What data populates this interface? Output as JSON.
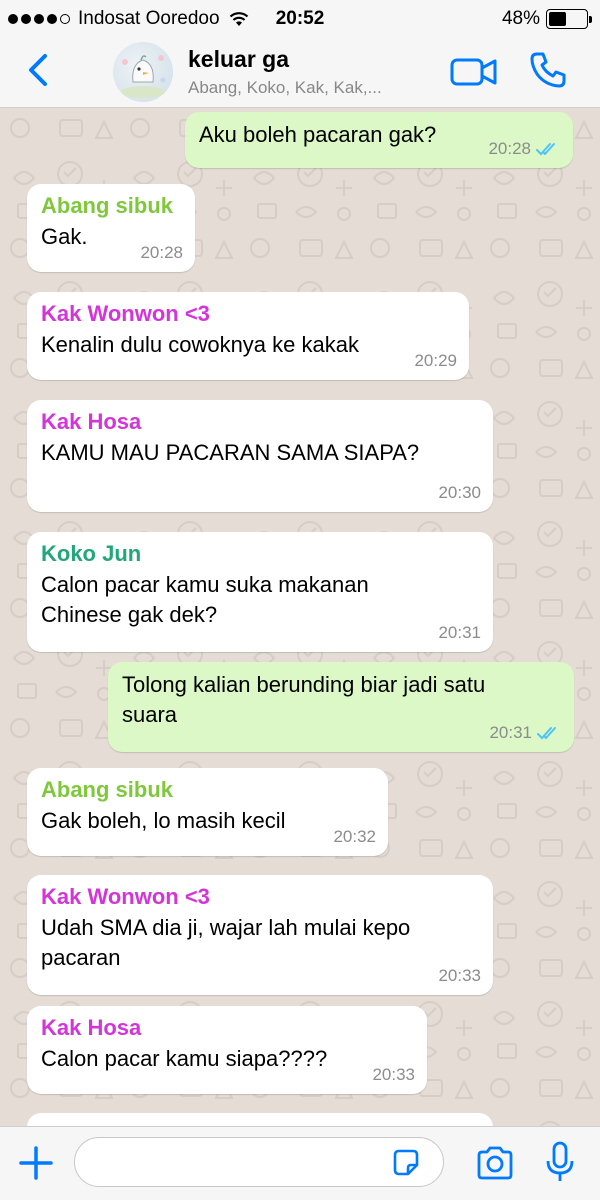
{
  "status_bar": {
    "carrier": "Indosat Ooredoo",
    "time": "20:52",
    "battery": "48%",
    "battery_level": 0.48,
    "signal_bars": 4
  },
  "header": {
    "title": "keluar ga",
    "members": "Abang, Koko, Kak, Kak,...",
    "icons": [
      "back-chevron-icon",
      "group-avatar",
      "video-call-icon",
      "phone-icon"
    ]
  },
  "messages": [
    {
      "direction": "out",
      "sender": "",
      "text": "Aku boleh pacaran gak?",
      "time": "20:28",
      "read": true
    },
    {
      "direction": "in",
      "sender": "Abang sibuk",
      "sender_color": "#7fc83c",
      "text": "Gak.",
      "time": "20:28"
    },
    {
      "direction": "in",
      "sender": "Kak Wonwon <3",
      "sender_color": "#d335d8",
      "text": "Kenalin dulu cowoknya ke kakak",
      "time": "20:29"
    },
    {
      "direction": "in",
      "sender": "Kak Hosa",
      "sender_color": "#d335d8",
      "text": "KAMU MAU PACARAN SAMA SIAPA?",
      "time": "20:30"
    },
    {
      "direction": "in",
      "sender": "Koko Jun",
      "sender_color": "#22a67a",
      "text": "Calon pacar kamu suka makanan\nChinese gak dek?",
      "time": "20:31"
    },
    {
      "direction": "out",
      "sender": "",
      "text": "Tolong kalian berunding biar jadi satu\nsuara",
      "time": "20:31",
      "read": true
    },
    {
      "direction": "in",
      "sender": "Abang sibuk",
      "sender_color": "#7fc83c",
      "text": "Gak boleh, lo masih kecil",
      "time": "20:32"
    },
    {
      "direction": "in",
      "sender": "Kak Wonwon <3",
      "sender_color": "#d335d8",
      "text": "Udah SMA dia ji, wajar lah mulai kepo\npacaran",
      "time": "20:33"
    },
    {
      "direction": "in",
      "sender": "Kak Hosa",
      "sender_color": "#d335d8",
      "text": "Calon pacar kamu siapa????",
      "time": "20:33"
    }
  ],
  "input_bar": {
    "placeholder": "",
    "icons": [
      "plus-icon",
      "sticker-icon",
      "camera-icon",
      "microphone-icon"
    ]
  },
  "colors": {
    "accent": "#007aff",
    "outgoing_bubble": "#dcf8c6",
    "incoming_bubble": "#ffffff",
    "read_ticks": "#4fc3f7",
    "chat_background": "#e5ddd5"
  }
}
